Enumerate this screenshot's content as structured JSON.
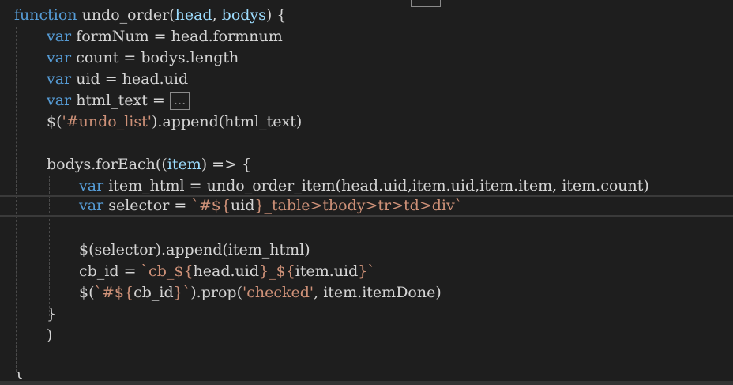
{
  "editor": {
    "lines": [
      {
        "tokens": [
          {
            "t": "function ",
            "c": "kw"
          },
          {
            "t": "undo_order",
            "c": "fn"
          },
          {
            "t": "(",
            "c": "plain"
          },
          {
            "t": "head",
            "c": "param"
          },
          {
            "t": ", ",
            "c": "plain"
          },
          {
            "t": "bodys",
            "c": "param"
          },
          {
            "t": ") {",
            "c": "plain"
          }
        ]
      },
      {
        "tokens": [
          {
            "t": "var ",
            "c": "kw"
          },
          {
            "t": "formNum = head.formnum",
            "c": "plain"
          }
        ]
      },
      {
        "tokens": [
          {
            "t": "var ",
            "c": "kw"
          },
          {
            "t": "count = bodys.length",
            "c": "plain"
          }
        ]
      },
      {
        "tokens": [
          {
            "t": "var ",
            "c": "kw"
          },
          {
            "t": "uid = head.uid",
            "c": "plain"
          }
        ]
      },
      {
        "tokens": [
          {
            "t": "var ",
            "c": "kw"
          },
          {
            "t": "html_text = ",
            "c": "plain"
          },
          {
            "t": "...",
            "c": "fold"
          }
        ]
      },
      {
        "tokens": [
          {
            "t": "$(",
            "c": "plain"
          },
          {
            "t": "'#undo_list'",
            "c": "str"
          },
          {
            "t": ").append(html_text)",
            "c": "plain"
          }
        ]
      },
      {
        "tokens": []
      },
      {
        "tokens": [
          {
            "t": "bodys.forEach((",
            "c": "plain"
          },
          {
            "t": "item",
            "c": "param"
          },
          {
            "t": ") => {",
            "c": "plain"
          }
        ]
      },
      {
        "tokens": [
          {
            "t": "var ",
            "c": "kw"
          },
          {
            "t": "item_html = undo_order_item(head.uid,item.uid,item.item, item.count)",
            "c": "plain"
          }
        ]
      },
      {
        "tokens": [
          {
            "t": "var ",
            "c": "kw"
          },
          {
            "t": "selector = ",
            "c": "plain"
          },
          {
            "t": "`#${",
            "c": "str"
          },
          {
            "t": "uid",
            "c": "plain"
          },
          {
            "t": "}_table>tbody>tr>td>div`",
            "c": "str"
          }
        ]
      },
      {
        "tokens": []
      },
      {
        "tokens": [
          {
            "t": "$(selector).append(item_html)",
            "c": "plain"
          }
        ]
      },
      {
        "tokens": [
          {
            "t": "cb_id = ",
            "c": "plain"
          },
          {
            "t": "`cb_${",
            "c": "str"
          },
          {
            "t": "head.uid",
            "c": "plain"
          },
          {
            "t": "}_${",
            "c": "str"
          },
          {
            "t": "item.uid",
            "c": "plain"
          },
          {
            "t": "}`",
            "c": "str"
          }
        ]
      },
      {
        "tokens": [
          {
            "t": "$(",
            "c": "plain"
          },
          {
            "t": "`#${",
            "c": "str"
          },
          {
            "t": "cb_id",
            "c": "plain"
          },
          {
            "t": "}`",
            "c": "str"
          },
          {
            "t": ").prop(",
            "c": "plain"
          },
          {
            "t": "'checked'",
            "c": "str"
          },
          {
            "t": ", item.itemDone)",
            "c": "plain"
          }
        ]
      },
      {
        "tokens": [
          {
            "t": "}",
            "c": "plain"
          }
        ]
      },
      {
        "tokens": [
          {
            "t": ")",
            "c": "plain"
          }
        ]
      },
      {
        "tokens": []
      },
      {
        "tokens": [
          {
            "t": "}",
            "c": "plain"
          }
        ]
      }
    ]
  }
}
